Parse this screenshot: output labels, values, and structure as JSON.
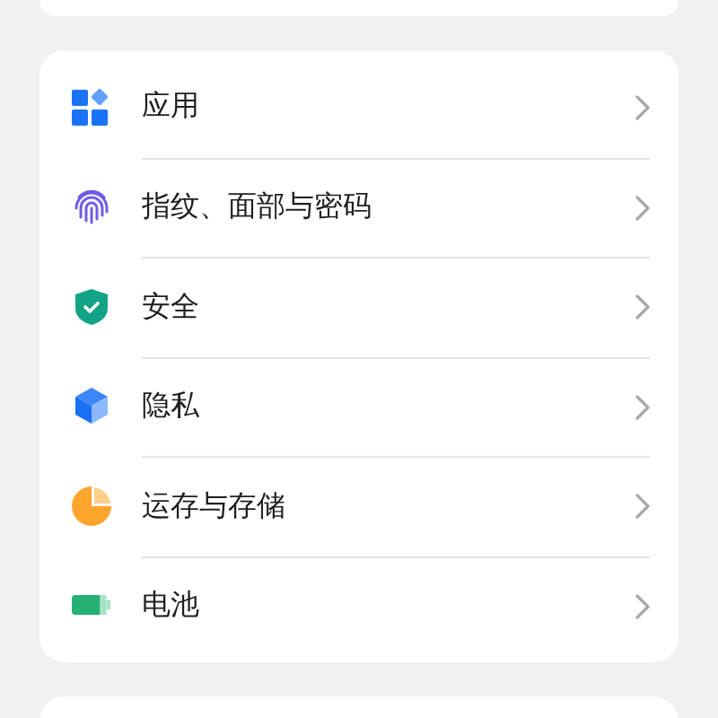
{
  "settings_items": [
    {
      "kind": "apps",
      "label": "应用"
    },
    {
      "kind": "fingerprint",
      "label": "指纹、面部与密码"
    },
    {
      "kind": "security",
      "label": "安全"
    },
    {
      "kind": "privacy",
      "label": "隐私"
    },
    {
      "kind": "storage",
      "label": "运存与存储"
    },
    {
      "kind": "battery",
      "label": "电池"
    }
  ]
}
